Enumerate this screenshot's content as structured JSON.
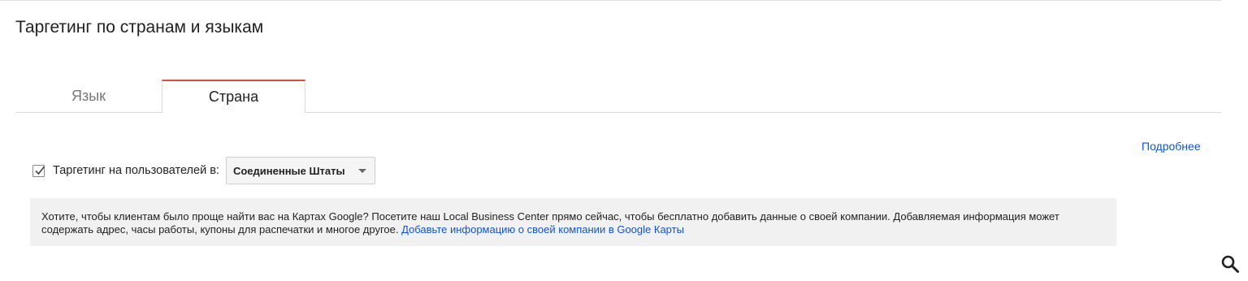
{
  "page": {
    "title": "Таргетинг по странам и языкам"
  },
  "tabs": [
    {
      "label": "Язык",
      "active": false
    },
    {
      "label": "Страна",
      "active": true
    }
  ],
  "more_link": "Подробнее",
  "targeting": {
    "checked": true,
    "label": "Таргетинг на пользователей в:",
    "selected_country": "Соединенные Штаты"
  },
  "info": {
    "text": "Хотите, чтобы клиентам было проще найти вас на Картах Google? Посетите наш Local Business Center прямо сейчас, чтобы бесплатно добавить данные о своей компании. Добавляемая информация может содержать адрес, часы работы, купоны для распечатки и многое другое.",
    "link_text": "Добавьте информацию о своей компании в Google Карты"
  },
  "icons": {
    "checkbox": "checkmark-icon",
    "dropdown": "caret-down-icon",
    "search": "search-icon"
  },
  "colors": {
    "accent_tab": "#dd4b39",
    "link": "#1155cc",
    "info_bg": "#f1f1f1"
  }
}
